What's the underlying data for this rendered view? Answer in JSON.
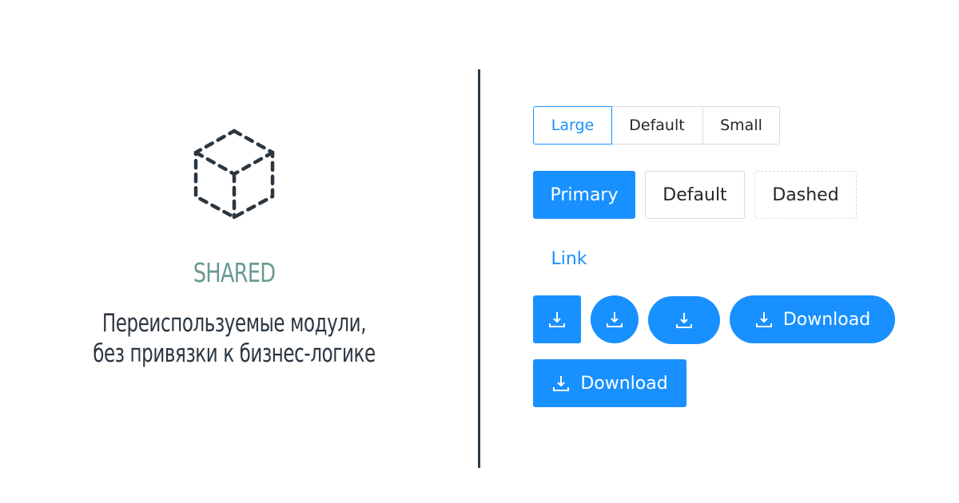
{
  "colors": {
    "primary": "#1890ff",
    "heading_accent": "#6a9a92",
    "text_dark": "#2b3640",
    "divider": "#2e3a46",
    "border": "#d9d9d9"
  },
  "left_panel": {
    "icon": "dashed-cube-icon",
    "title": "SHARED",
    "subtitle_line1": "Переиспользуемые модули,",
    "subtitle_line2": "без привязки к бизнес-логике"
  },
  "size_switcher": {
    "options": [
      "Large",
      "Default",
      "Small"
    ],
    "selected": "Large"
  },
  "buttons": {
    "primary": "Primary",
    "default": "Default",
    "dashed": "Dashed",
    "link": "Link"
  },
  "download_buttons": {
    "icon": "download-icon",
    "label_round": "Download",
    "label_square": "Download"
  }
}
